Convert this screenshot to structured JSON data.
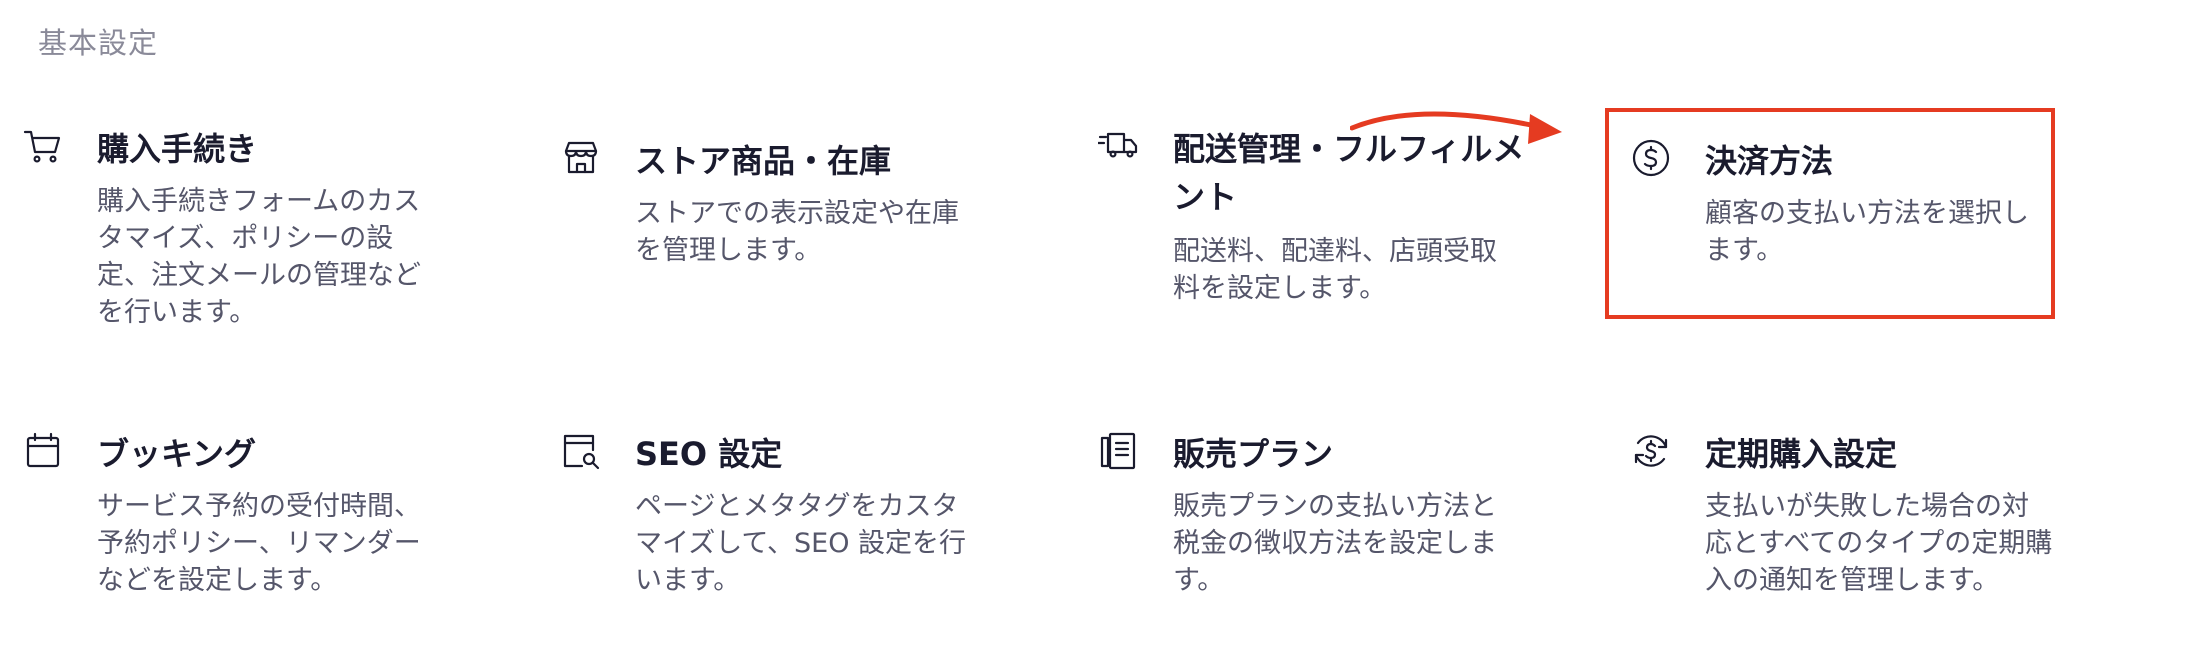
{
  "section_title": "基本設定",
  "cards": [
    {
      "title": "購入手続き",
      "desc": "購入手続きフォームのカスタマイズ、ポリシーの設定、注文メールの管理などを行います。",
      "icon": "cart-icon"
    },
    {
      "title": "ストア商品・在庫",
      "desc": "ストアでの表示設定や在庫を管理します。",
      "icon": "store-icon"
    },
    {
      "title": "配送管理・フルフィルメント",
      "desc": "配送料、配達料、店頭受取料を設定します。",
      "icon": "truck-icon"
    },
    {
      "title": "決済方法",
      "desc": "顧客の支払い方法を選択します。",
      "icon": "dollar-coin-icon"
    },
    {
      "title": "ブッキング",
      "desc": "サービス予約の受付時間、予約ポリシー、リマンダーなどを設定します。",
      "icon": "calendar-icon"
    },
    {
      "title": "SEO 設定",
      "desc": "ページとメタタグをカスタマイズして、SEO 設定を行います。",
      "icon": "page-search-icon"
    },
    {
      "title": "販売プラン",
      "desc": "販売プランの支払い方法と税金の徴収方法を設定します。",
      "icon": "plans-icon"
    },
    {
      "title": "定期購入設定",
      "desc": "支払いが失敗した場合の対応とすべてのタイプの定期購入の通知を管理します。",
      "icon": "recurring-payment-icon"
    }
  ],
  "colors": {
    "highlight": "#e53b21",
    "title_text": "#1a1b2e",
    "desc_text": "#55566a",
    "section_title_text": "#8a8a99"
  }
}
